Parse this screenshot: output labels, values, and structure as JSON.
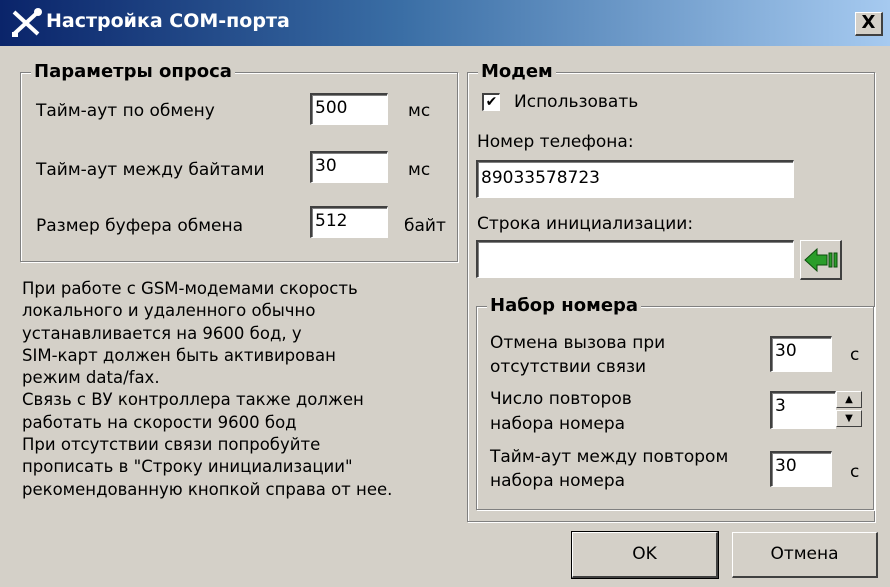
{
  "window": {
    "title": "Настройка COM-порта",
    "close_label": "X"
  },
  "polling": {
    "legend": "Параметры опроса",
    "exchange_timeout": {
      "label": "Тайм-аут по обмену",
      "value": "500",
      "unit": "мс"
    },
    "byte_timeout": {
      "label": "Тайм-аут между байтами",
      "value": "30",
      "unit": "мс"
    },
    "buffer_size": {
      "label": "Размер буфера обмена",
      "value": "512",
      "unit": "байт"
    }
  },
  "info_text": "  При работе с GSM-модемами скорость\nлокального и удаленного обычно\nустанавливается на 9600 бод, у\nSIM-карт должен быть активирован\nрежим data/fax.\n  Связь с ВУ контроллера также должен\nработать на скорости 9600 бод\n  При отсутствии связи попробуйте\nпрописать в \"Строку инициализации\"\nрекомендованную кнопкой справа от нее.",
  "modem": {
    "legend": "Модем",
    "use_label": "Использовать",
    "use_checked": "✔",
    "phone_label": "Номер телефона:",
    "phone_value": "89033578723",
    "init_label": "Строка инициализации:",
    "init_value": ""
  },
  "dial": {
    "legend": "Набор номера",
    "cancel_label_1": "Отмена вызова при",
    "cancel_label_2": "отсутствии связи",
    "cancel_value": "30",
    "cancel_unit": "с",
    "retries_label_1": "Число повторов",
    "retries_label_2": "набора номера",
    "retries_value": "3",
    "retry_timeout_label_1": "Тайм-аут между повтором",
    "retry_timeout_label_2": "набора номера",
    "retry_timeout_value": "30",
    "retry_timeout_unit": "с"
  },
  "buttons": {
    "ok": "OK",
    "cancel": "Отмена"
  },
  "colors": {
    "titlebar_start": "#0a246a",
    "titlebar_end": "#a6caf0",
    "dialog_bg": "#d4d0c8",
    "arrow_green": "#2a9d2a"
  }
}
